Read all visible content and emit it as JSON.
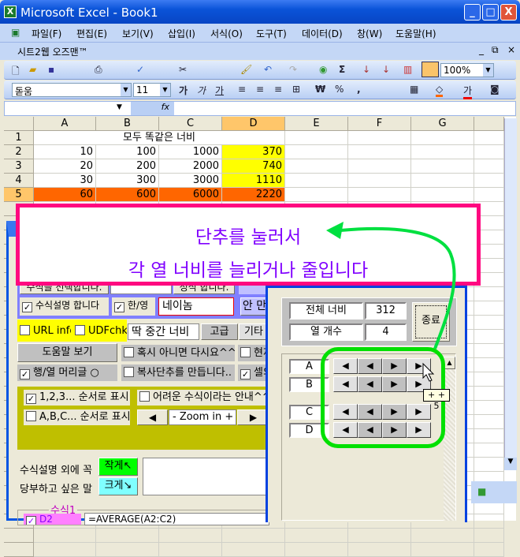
{
  "window": {
    "title": "Microsoft Excel - Book1",
    "min": "_",
    "max": "□",
    "close": "X"
  },
  "menu": [
    "파일(F)",
    "편집(E)",
    "보기(V)",
    "삽입(I)",
    "서식(O)",
    "도구(T)",
    "데이터(D)",
    "창(W)",
    "도움말(H)"
  ],
  "doc": {
    "title": "시트2웹 오즈맨™",
    "min": "_",
    "restore": "⧉",
    "close": "×"
  },
  "toolbar": {
    "zoom": "100%",
    "font": "돋움",
    "size": "11",
    "bold": "가",
    "italic": "가",
    "underline": "가",
    "currency": "₩",
    "percent": "%",
    "comma": ",",
    "fx": "fx"
  },
  "sheet": {
    "columns": [
      "A",
      "B",
      "C",
      "D",
      "E",
      "F",
      "G"
    ],
    "rows": [
      "1",
      "2",
      "3",
      "4",
      "5"
    ],
    "title": "모두 똑같은 너비",
    "data": [
      [
        "10",
        "100",
        "1000",
        "370"
      ],
      [
        "20",
        "200",
        "2000",
        "740"
      ],
      [
        "30",
        "300",
        "3000",
        "1110"
      ],
      [
        "60",
        "600",
        "6000",
        "2220"
      ]
    ],
    "colors": {
      "highlight": "#ffff00",
      "total": "#ff6600"
    }
  },
  "callout": {
    "line1": "단추를 눌러서",
    "line2": "각 열 너비를 늘리거나 줄입니다",
    "border": "#ff0880",
    "text": "#8000ff",
    "arrow": "#00e040"
  },
  "form": {
    "top_btn1": "수식을 선택합니다.",
    "top_btn2": "정식 합니다.",
    "explain": "수식설명 합니다",
    "hanyoung": "한/영",
    "name_value": "네이놈",
    "an_btn": "안 만",
    "url": "URL info",
    "udf": "UDFchk",
    "width_field": "딱 중간 너비",
    "advanced": "고급",
    "etc": "기타",
    "help": "도움말 보기",
    "maybe": "혹시 아니면 다시요^^",
    "current": "현재",
    "headers": "행/열 머리글 ○",
    "copy": "복사단추를 만듭니다..",
    "cell": "셀의",
    "order_num": "1,2,3... 순서로 표시",
    "order_alpha": "A,B,C... 순서로 표시",
    "hard": "어려운 수식이라는 안내^^",
    "zoom": "- Zoom in +",
    "memo1": "수식설명 외에 꼭",
    "memo2": "당부하고 싶은 말",
    "smaller": "작게↖",
    "bigger": "크게↘",
    "frame": "수식1",
    "d2": "D2",
    "formula": "=AVERAGE(A2:C2)"
  },
  "dialog": {
    "total_label": "전체 너비",
    "total_value": "312",
    "count_label": "열 개수",
    "count_value": "4",
    "close": "종료",
    "columns": [
      "A",
      "B",
      "C",
      "D"
    ],
    "tooltip": "+ + 5"
  }
}
